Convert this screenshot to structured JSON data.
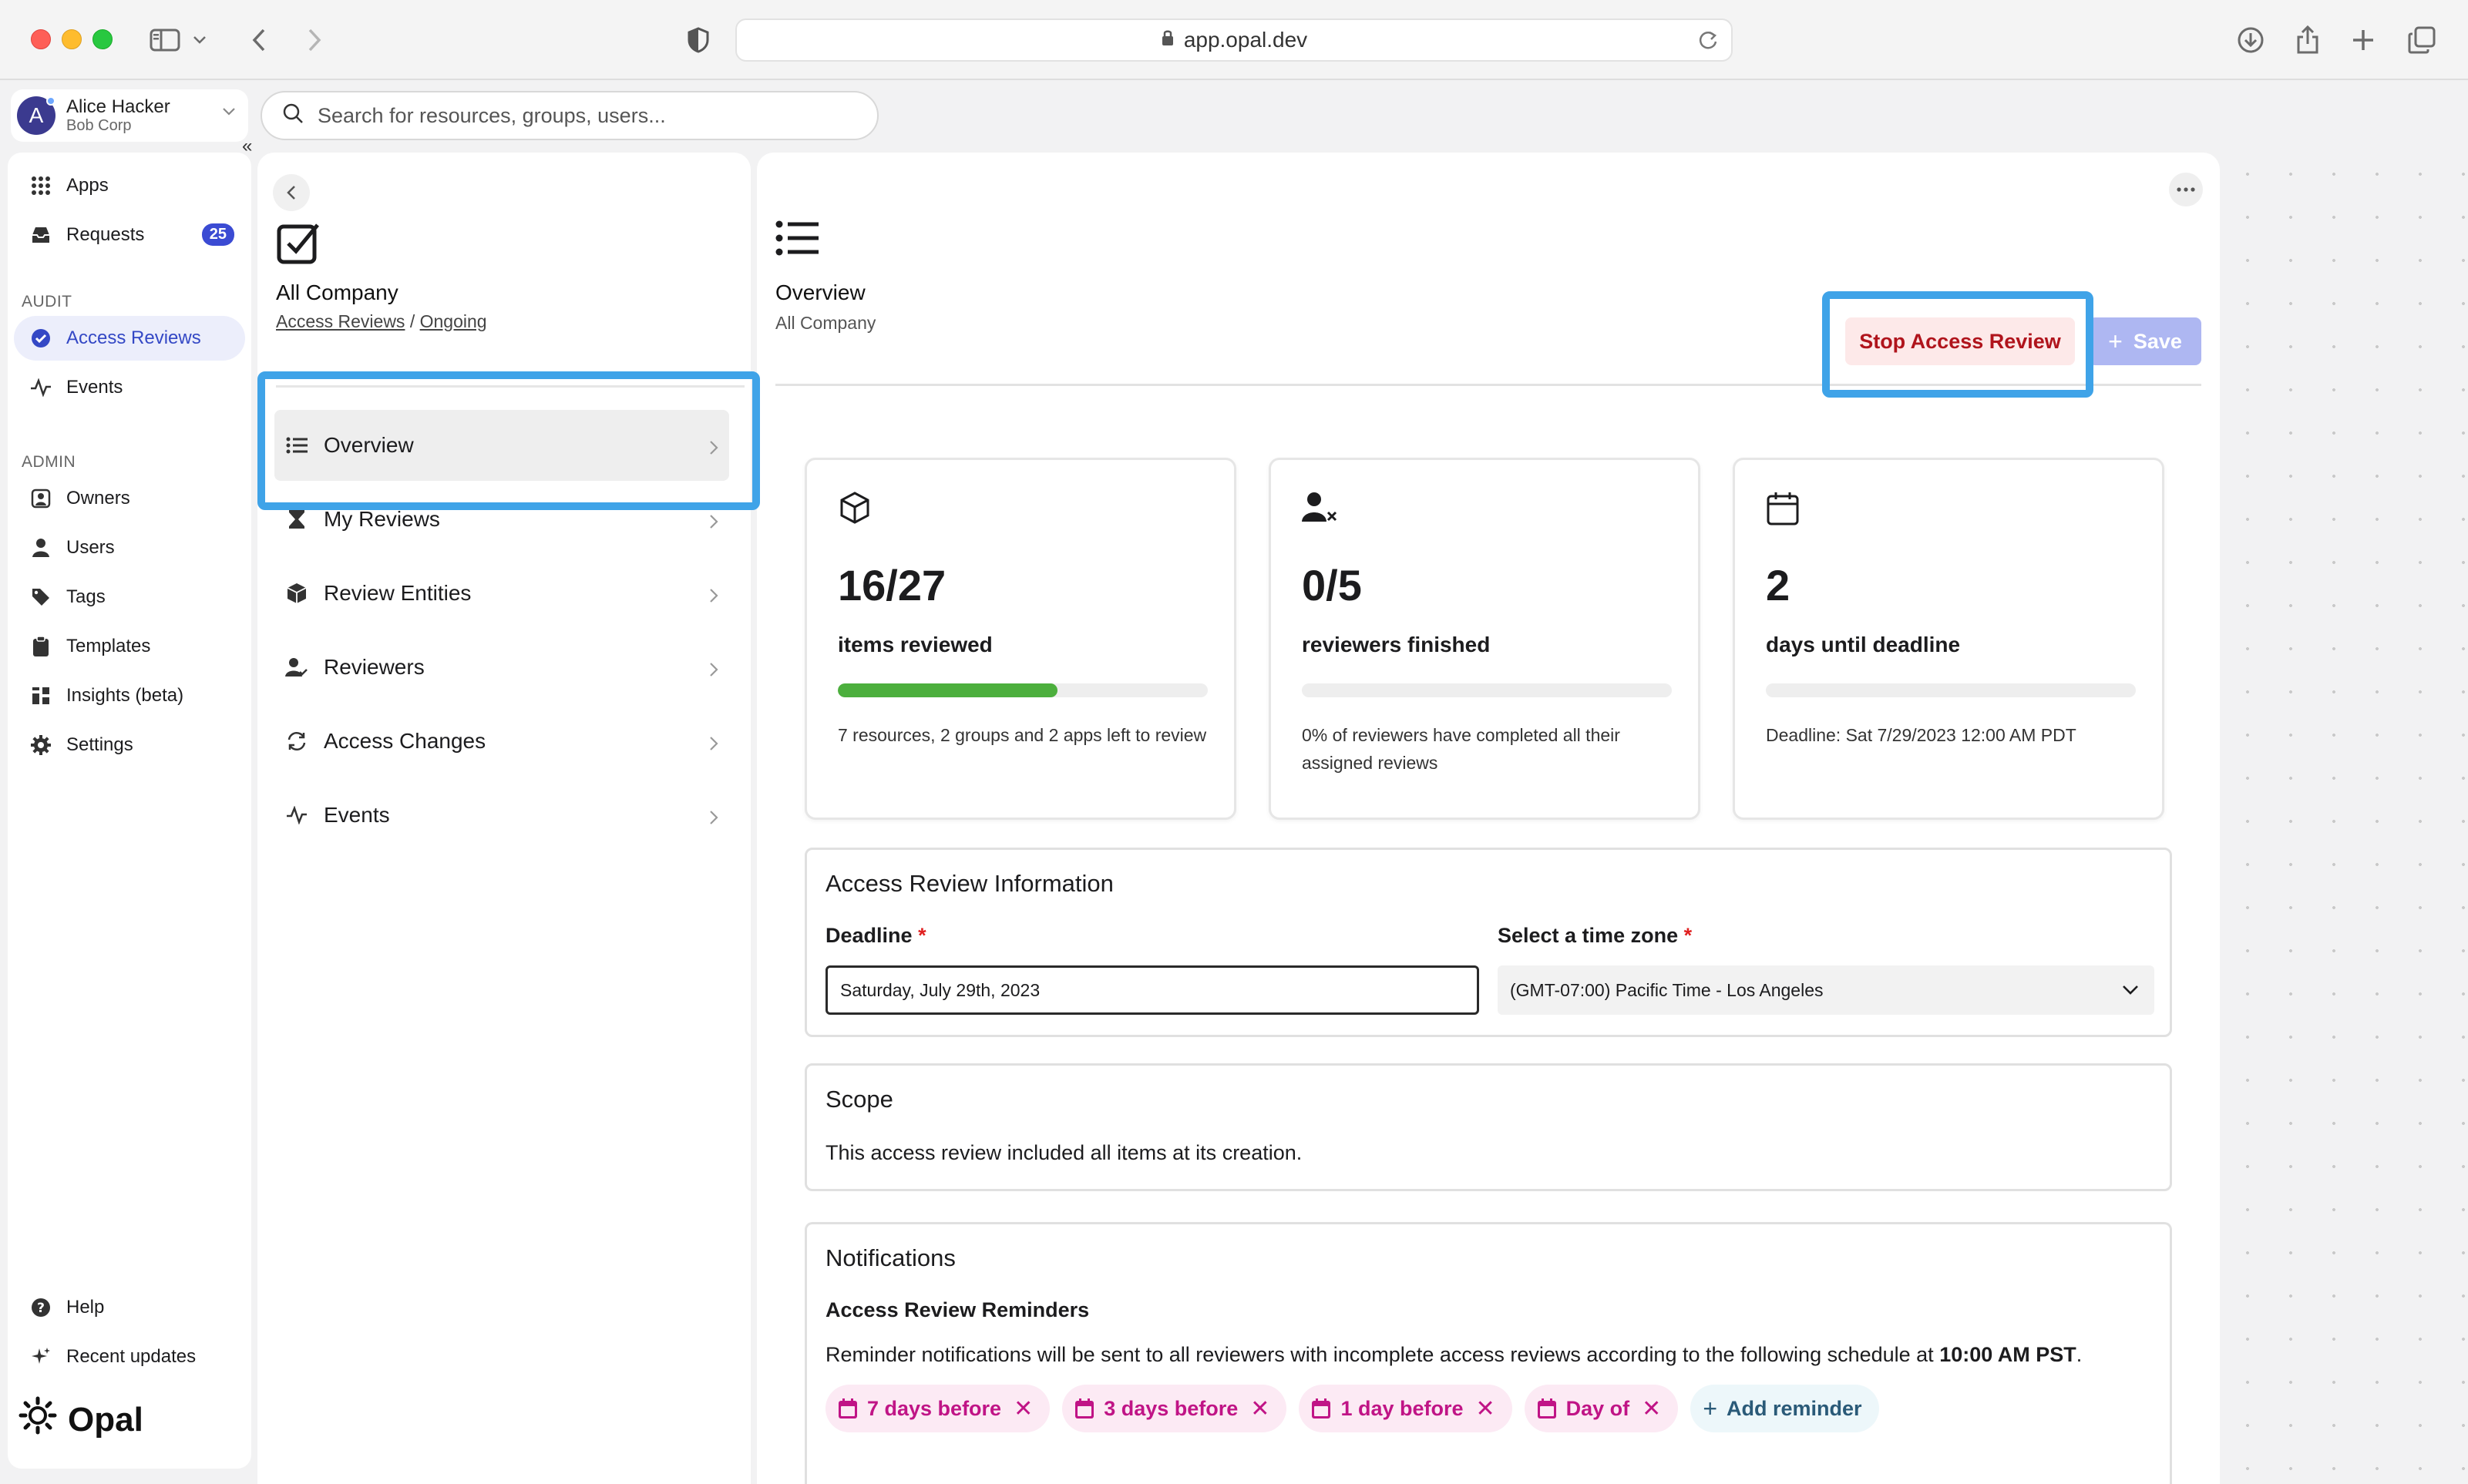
{
  "browser": {
    "url": "app.opal.dev"
  },
  "user": {
    "initial": "A",
    "name": "Alice Hacker",
    "org": "Bob Corp"
  },
  "search": {
    "placeholder": "Search for resources, groups, users..."
  },
  "nav": {
    "apps": "Apps",
    "requests": "Requests",
    "requests_badge": "25",
    "audit_section": "AUDIT",
    "access_reviews": "Access Reviews",
    "events": "Events",
    "admin_section": "ADMIN",
    "owners": "Owners",
    "users": "Users",
    "tags": "Tags",
    "templates": "Templates",
    "insights": "Insights (beta)",
    "settings": "Settings",
    "help": "Help",
    "recent_updates": "Recent updates",
    "logo": "Opal"
  },
  "middle": {
    "title": "All Company",
    "crumb_root": "Access Reviews",
    "crumb_sep": "/",
    "crumb_current": "Ongoing",
    "menu": [
      {
        "label": "Overview"
      },
      {
        "label": "My Reviews"
      },
      {
        "label": "Review Entities"
      },
      {
        "label": "Reviewers"
      },
      {
        "label": "Access Changes"
      },
      {
        "label": "Events"
      }
    ]
  },
  "main": {
    "title": "Overview",
    "subtitle": "All Company",
    "stop_label": "Stop Access Review",
    "save_label": "Save",
    "stats": [
      {
        "value": "16/27",
        "label": "items reviewed",
        "progress": 0.593,
        "desc": "7 resources, 2 groups and 2 apps left to review"
      },
      {
        "value": "0/5",
        "label": "reviewers finished",
        "progress": 0.0,
        "desc": "0% of reviewers have completed all their assigned reviews"
      },
      {
        "value": "2",
        "label": "days until deadline",
        "progress": 0.0,
        "desc": "Deadline: Sat 7/29/2023 12:00 AM PDT"
      }
    ],
    "info": {
      "title": "Access Review Information",
      "deadline_label": "Deadline",
      "deadline_value": "Saturday, July 29th, 2023",
      "tz_label": "Select a time zone",
      "tz_value": "(GMT-07:00) Pacific Time - Los Angeles",
      "required_mark": "*"
    },
    "scope": {
      "title": "Scope",
      "text": "This access review included all items at its creation."
    },
    "notifications": {
      "title": "Notifications",
      "reminders_label": "Access Review Reminders",
      "text_prefix": "Reminder notifications will be sent to all reviewers with incomplete access reviews according to the following schedule at ",
      "time": "10:00 AM PST",
      "text_suffix": ".",
      "reminders": [
        {
          "label": "7 days before"
        },
        {
          "label": "3 days before"
        },
        {
          "label": "1 day before"
        },
        {
          "label": "Day of"
        }
      ],
      "add_label": "Add reminder"
    }
  },
  "colors": {
    "accent": "#3b4bd3",
    "highlight": "#3fa3e8",
    "danger": "#b0141c",
    "progress": "#4caf3d",
    "reminder": "#c01486"
  }
}
